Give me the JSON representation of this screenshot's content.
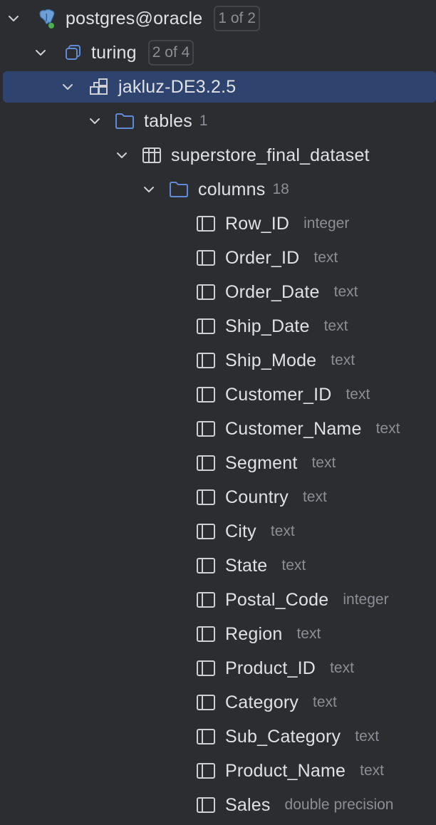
{
  "tree": {
    "connection": {
      "label": "postgres@oracle",
      "badge": "1 of 2",
      "icon": "postgres-elephant-icon"
    },
    "database": {
      "label": "turing",
      "badge": "2 of 4",
      "icon": "database-icon"
    },
    "schema": {
      "label": "jakluz-DE3.2.5",
      "icon": "schema-icon"
    },
    "tables_folder": {
      "label": "tables",
      "count": "1",
      "icon": "folder-icon"
    },
    "table": {
      "label": "superstore_final_dataset",
      "icon": "table-icon"
    },
    "columns_folder": {
      "label": "columns",
      "count": "18",
      "icon": "folder-icon"
    },
    "columns": [
      {
        "name": "Row_ID",
        "type": "integer"
      },
      {
        "name": "Order_ID",
        "type": "text"
      },
      {
        "name": "Order_Date",
        "type": "text"
      },
      {
        "name": "Ship_Date",
        "type": "text"
      },
      {
        "name": "Ship_Mode",
        "type": "text"
      },
      {
        "name": "Customer_ID",
        "type": "text"
      },
      {
        "name": "Customer_Name",
        "type": "text"
      },
      {
        "name": "Segment",
        "type": "text"
      },
      {
        "name": "Country",
        "type": "text"
      },
      {
        "name": "City",
        "type": "text"
      },
      {
        "name": "State",
        "type": "text"
      },
      {
        "name": "Postal_Code",
        "type": "integer"
      },
      {
        "name": "Region",
        "type": "text"
      },
      {
        "name": "Product_ID",
        "type": "text"
      },
      {
        "name": "Category",
        "type": "text"
      },
      {
        "name": "Sub_Category",
        "type": "text"
      },
      {
        "name": "Product_Name",
        "type": "text"
      },
      {
        "name": "Sales",
        "type": "double precision"
      }
    ]
  },
  "colors": {
    "background": "#2b2d30",
    "selection": "#2e436e",
    "text": "#dfe1e5",
    "hint": "#8b8e94",
    "folder": "#5e8ad6"
  }
}
